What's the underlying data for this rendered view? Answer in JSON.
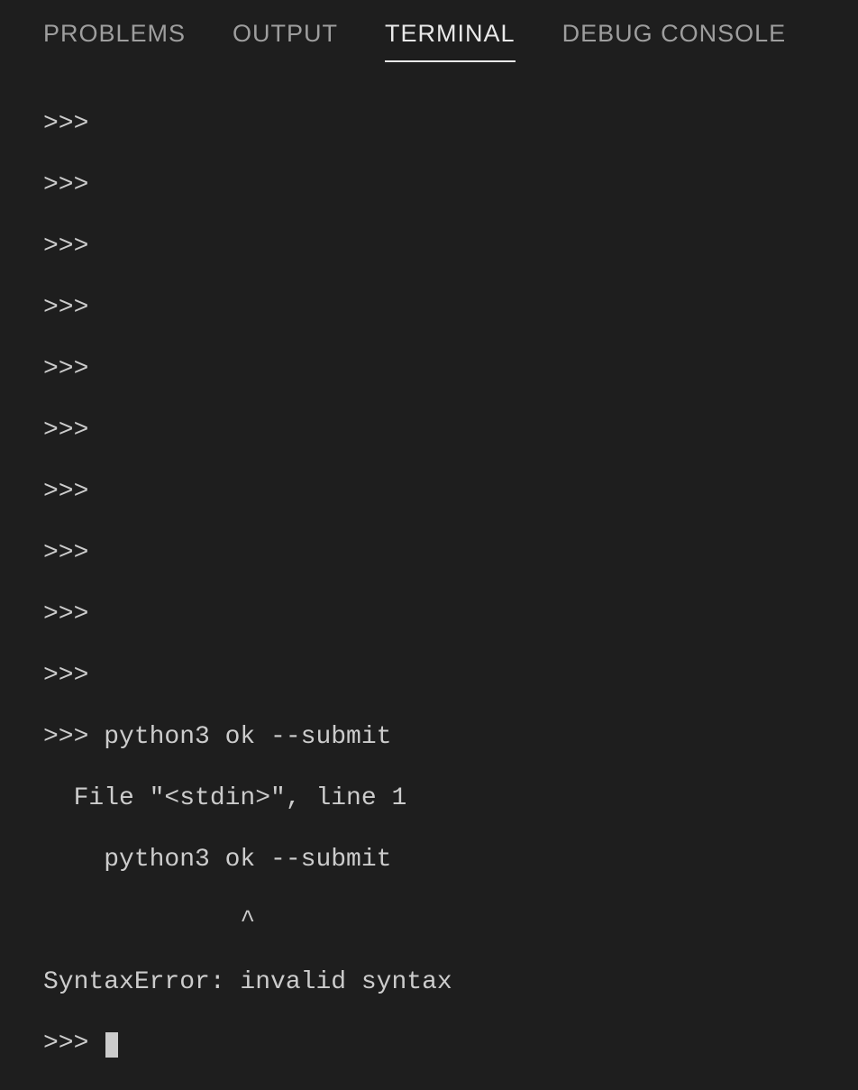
{
  "tabs": {
    "problems": "PROBLEMS",
    "output": "OUTPUT",
    "terminal": "TERMINAL",
    "debug_console": "DEBUG CONSOLE"
  },
  "terminal": {
    "lines": [
      ">>>",
      ">>>",
      ">>>",
      ">>>",
      ">>>",
      ">>>",
      ">>>",
      ">>>",
      ">>>",
      ">>>",
      ">>> python3 ok --submit",
      "  File \"<stdin>\", line 1",
      "    python3 ok --submit",
      "             ^",
      "SyntaxError: invalid syntax"
    ],
    "current_prompt": ">>> "
  }
}
